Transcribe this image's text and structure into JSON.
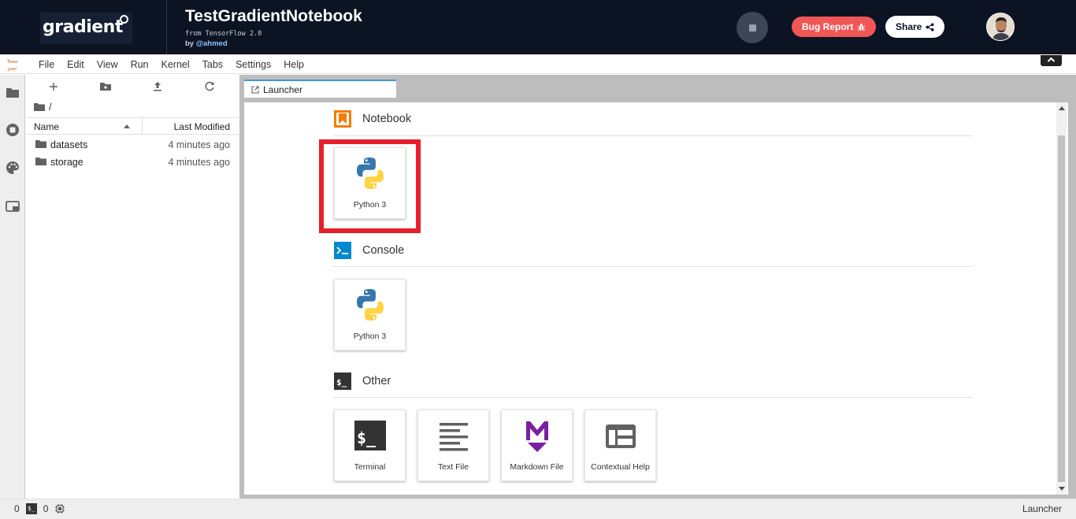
{
  "header": {
    "logo_text": "gradient",
    "notebook_title": "TestGradientNotebook",
    "subtitle": "from TensorFlow 2.0",
    "author_prefix": "by ",
    "author": "@ahmed",
    "bug_report_label": "Bug Report",
    "share_label": "Share"
  },
  "menu": {
    "items": [
      "File",
      "Edit",
      "View",
      "Run",
      "Kernel",
      "Tabs",
      "Settings",
      "Help"
    ]
  },
  "file_browser": {
    "breadcrumb": "/",
    "columns": {
      "name": "Name",
      "modified": "Last Modified"
    },
    "rows": [
      {
        "name": "datasets",
        "modified": "4 minutes ago"
      },
      {
        "name": "storage",
        "modified": "4 minutes ago"
      }
    ]
  },
  "tabs": [
    {
      "label": "Launcher"
    }
  ],
  "launcher": {
    "sections": [
      {
        "title": "Notebook",
        "cards": [
          {
            "label": "Python 3"
          }
        ]
      },
      {
        "title": "Console",
        "cards": [
          {
            "label": "Python 3"
          }
        ]
      },
      {
        "title": "Other",
        "cards": [
          {
            "label": "Terminal"
          },
          {
            "label": "Text File"
          },
          {
            "label": "Markdown File"
          },
          {
            "label": "Contextual Help"
          }
        ]
      }
    ]
  },
  "status": {
    "kernels": "0",
    "terminals": "0",
    "terminal_icon_text": "$_",
    "mode": "Launcher"
  },
  "colors": {
    "header_bg": "#0c1423",
    "bug_report": "#f05656",
    "tab_accent": "#3e98d5",
    "highlight": "#e81e2a",
    "notebook_icon": "#f57c00",
    "console_icon": "#0288d1",
    "markdown_icon": "#7b1fa2"
  }
}
